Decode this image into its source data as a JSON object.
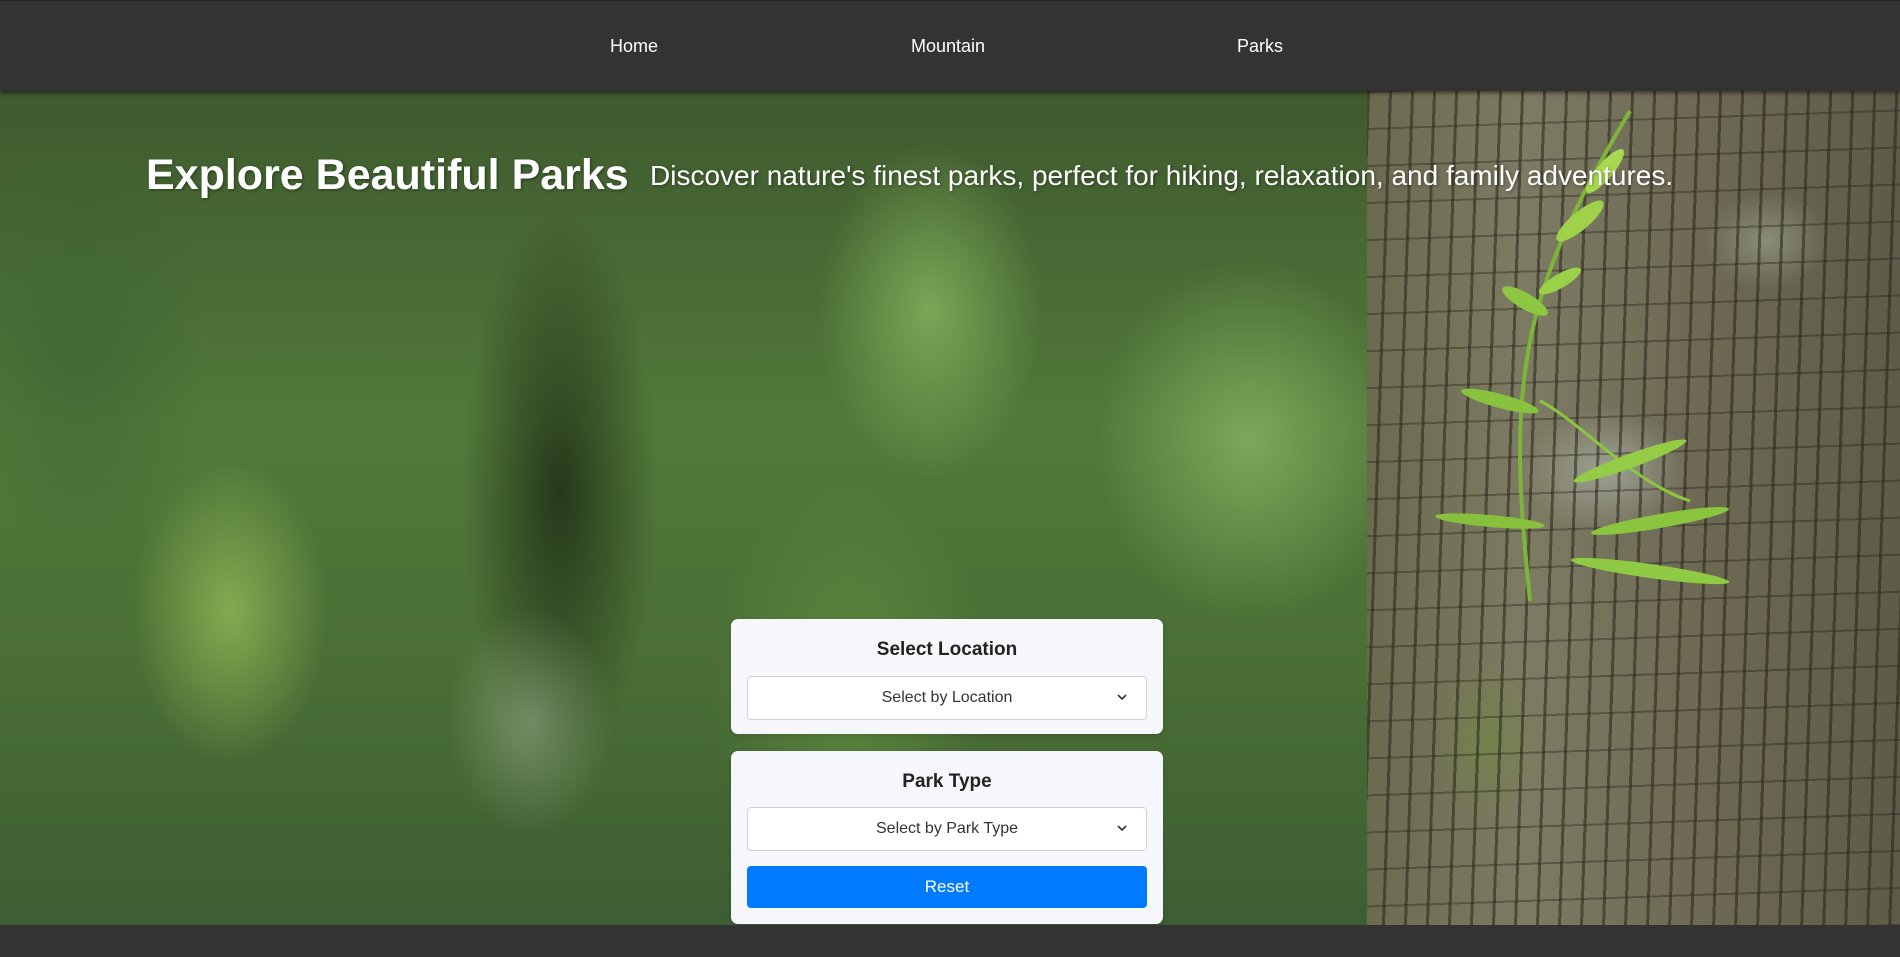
{
  "nav": {
    "items": [
      {
        "label": "Home"
      },
      {
        "label": "Mountain"
      },
      {
        "label": "Parks"
      }
    ]
  },
  "hero": {
    "title": "Explore Beautiful Parks",
    "subtitle": "Discover nature's finest parks, perfect for hiking, relaxation, and family adventures."
  },
  "filters": {
    "location": {
      "heading": "Select Location",
      "selected": "Select by Location",
      "icon": "chevron-down-icon"
    },
    "park_type": {
      "heading": "Park Type",
      "selected": "Select by Park Type",
      "icon": "chevron-down-icon"
    },
    "reset_label": "Reset"
  },
  "colors": {
    "nav_background": "#333333",
    "card_background": "#f6f7fa",
    "accent": "#007bff"
  }
}
